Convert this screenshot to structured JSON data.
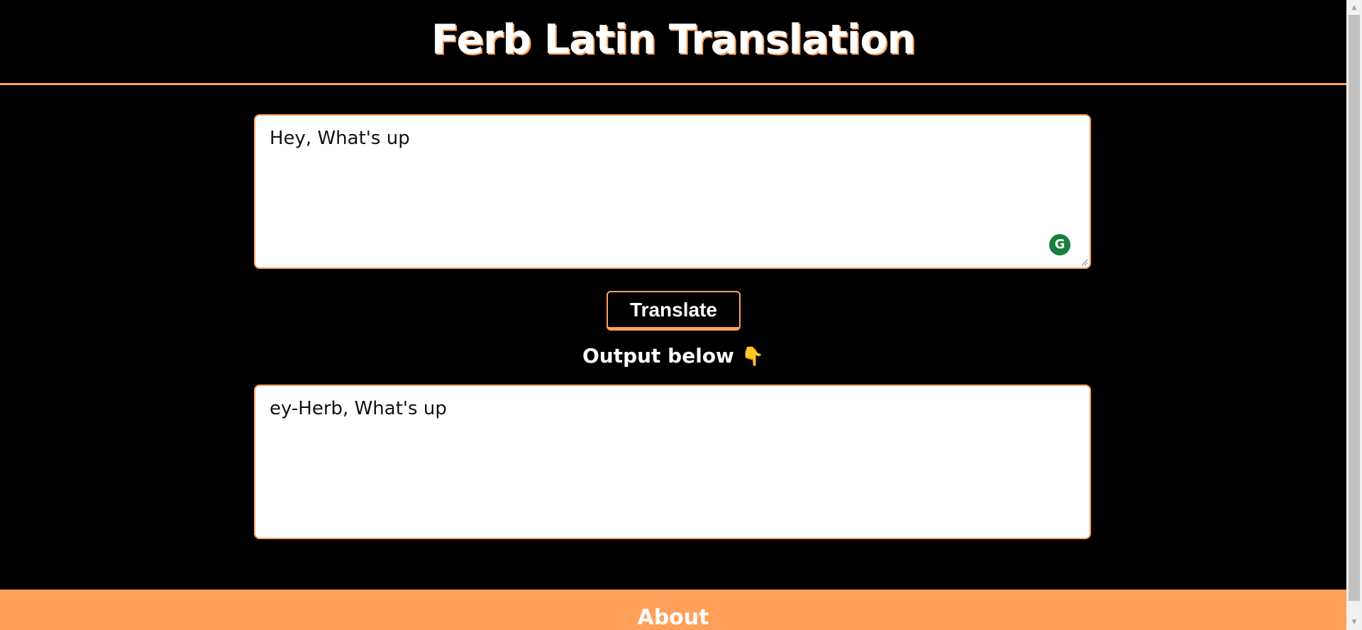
{
  "header": {
    "title": "Ferb Latin Translation"
  },
  "input": {
    "value": "Hey, What's up",
    "placeholder": ""
  },
  "translate_button": {
    "label": "Translate"
  },
  "output": {
    "label": "Output below",
    "emoji": "👇",
    "value": "ey-Herb, What's up"
  },
  "grammarly": {
    "icon": "grammarly-icon",
    "glyph": "G"
  },
  "footer": {
    "title": "About"
  },
  "colors": {
    "background": "#000000",
    "accent": "#ffa05a",
    "text": "#ffffff",
    "grammarly": "#15803d"
  }
}
